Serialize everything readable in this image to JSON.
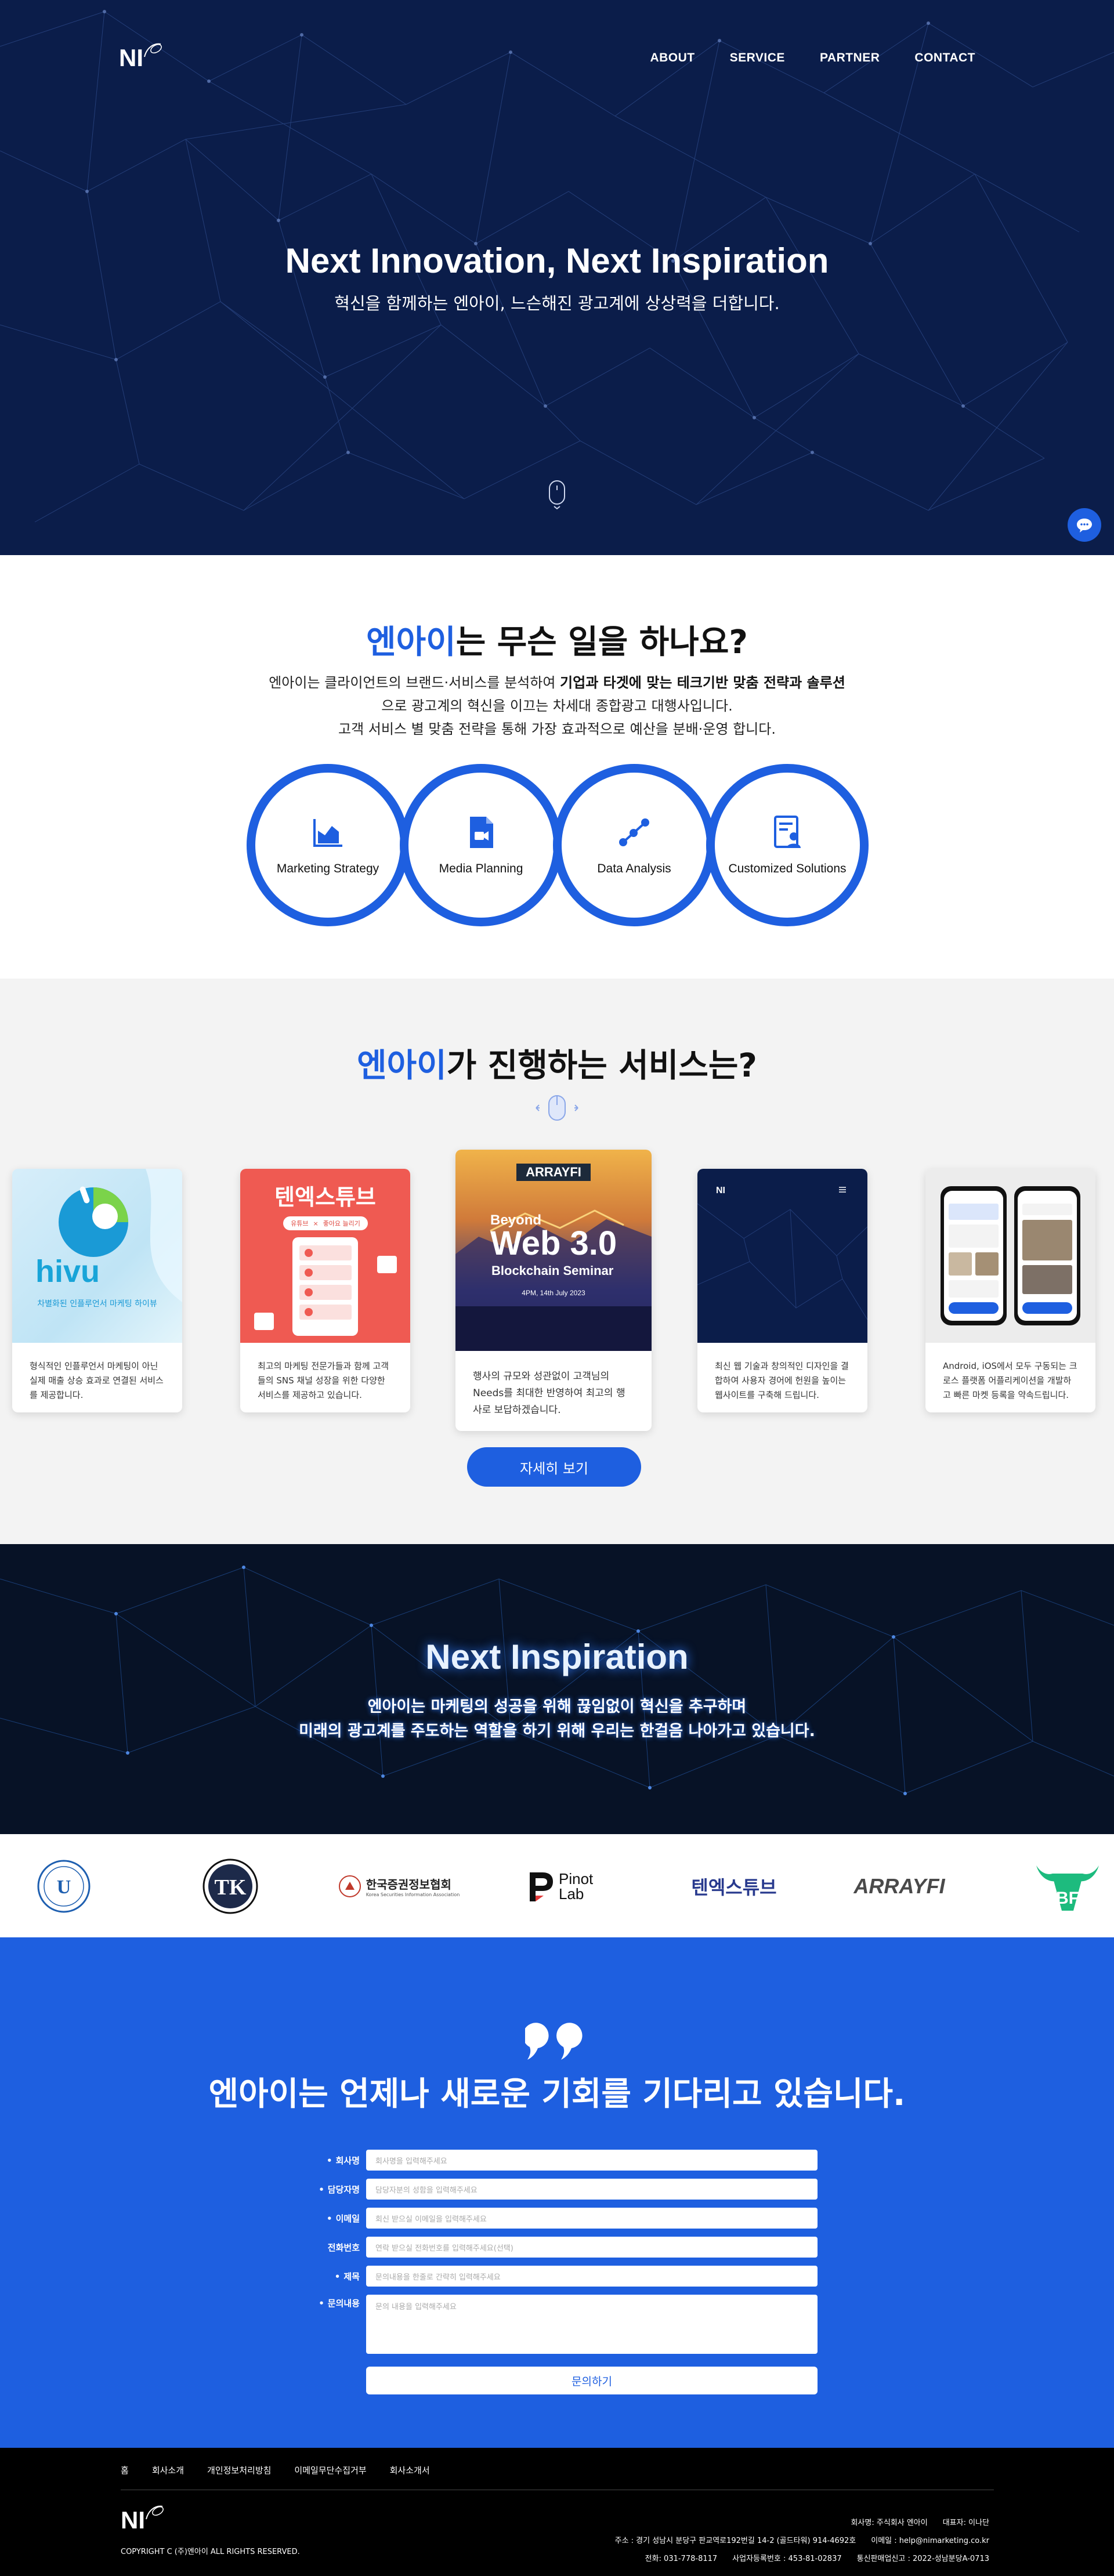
{
  "header": {
    "logo_text": "NI",
    "nav": [
      "ABOUT",
      "SERVICE",
      "PARTNER",
      "CONTACT"
    ]
  },
  "hero": {
    "title": "Next Innovation, Next Inspiration",
    "subtitle": "혁신을 함께하는 엔아이, 느슨해진 광고계에 상상력을 더합니다."
  },
  "what": {
    "title_highlight": "엔아이",
    "title_rest": "는 무슨 일을 하나요?",
    "line1_a": "엔아이는 클라이언트의 브랜드·서비스를 분석하여 ",
    "line1_b": "기업과 타겟에 맞는 테크기반 맞춤 전략과 솔루션",
    "line2": "으로 광고계의 혁신을 이끄는 차세대 종합광고 대행사입니다.",
    "line3": "고객 서비스 별 맞춤 전략을 통해 가장 효과적으로 예산을 분배·운영 합니다.",
    "circles": [
      "Marketing Strategy",
      "Media Planning",
      "Data Analysis",
      "Customized Solutions"
    ]
  },
  "services": {
    "title_highlight": "엔아이",
    "title_rest": "가 진행하는 서비스는?",
    "cards": [
      {
        "brand": "hivu",
        "caption": "차별화된 인플루언서 마케팅 하이뷰",
        "desc": "형식적인 인플루언서 마케팅이 아닌 실제 매출 상승 효과로 연결된 서비스를 제공합니다."
      },
      {
        "brand": "텐엑스튜브",
        "tag1": "유튜브",
        "tag2": "좋아요 늘리기",
        "desc": "최고의 마케팅 전문가들과 함께 고객들의 SNS 채널 성장을 위한 다양한 서비스를 제공하고 있습니다."
      },
      {
        "brand": "ARRAYFI",
        "headline1": "Beyond",
        "headline2": "Web 3.0",
        "headline3": "Blockchain Seminar",
        "date": "4PM, 14th July 2023",
        "desc": "행사의 규모와 성관없이 고객님의 Needs를 최대한 반영하여 최고의 행사로 보답하겠습니다."
      },
      {
        "brand": "NI",
        "desc": "최신 웹 기술과 창의적인 디자인을 결합하여 사용자 경어에 헌원을 높이는 웹사이트를 구축해 드립니다."
      },
      {
        "brand": "app",
        "desc": "Android, iOS에서 모두 구동되는 크로스 플랫폼 어플리케이션을 개발하고 빠른 마켓 등록을 약속드립니다."
      }
    ],
    "more_button": "자세히 보기"
  },
  "inspiration": {
    "title": "Next Inspiration",
    "line1": "엔아이는 마케팅의 성공을 위해 끊임없이 혁신을 추구하며",
    "line2": "미래의 광고계를 주도하는 역할을 하기 위해 우리는 한걸음 나아가고 있습니다."
  },
  "partners": [
    {
      "name": "U"
    },
    {
      "name": "TK"
    },
    {
      "name": "한국증권정보협회",
      "sub": "Korea Securities Information Association"
    },
    {
      "name": "Pinot Lab"
    },
    {
      "name": "텐엑스튜브"
    },
    {
      "name": "ARRAYFI"
    },
    {
      "name": "BF"
    }
  ],
  "contact": {
    "title": "엔아이는 언제나 새로운 기회를 기다리고 있습니다.",
    "fields": [
      {
        "label": "회사명",
        "required": true,
        "placeholder": "회사명을 입력해주세요"
      },
      {
        "label": "담당자명",
        "required": true,
        "placeholder": "담당자분의 성함을 입력해주세요"
      },
      {
        "label": "이메일",
        "required": true,
        "placeholder": "회신 받으실 이메일을 입력해주세요"
      },
      {
        "label": "전화번호",
        "required": false,
        "placeholder": "연락 받으실 전화번호를 입력해주세요(선택)"
      },
      {
        "label": "제목",
        "required": true,
        "placeholder": "문의내용을 한줄로 간략히 입력해주세요"
      },
      {
        "label": "문의내용",
        "required": true,
        "placeholder": "문의 내용을 입력해주세요"
      }
    ],
    "submit": "문의하기"
  },
  "footer": {
    "links": [
      "홈",
      "회사소개",
      "개인정보처리방침",
      "이메일무단수집거부",
      "회사소개서"
    ],
    "copyright": "COPYRIGHT C (주)엔아이 ALL RIGHTS RESERVED.",
    "company": "회사명: 주식회사 엔아이",
    "ceo": "대표자: 이나단",
    "address": "주소 : 경기 성남시 분당구 판교역로192번길 14-2 (골드타워) 914-4692호",
    "email": "이메일 : help@nimarketing.co.kr",
    "phone": "전화: 031-778-8117",
    "biz_no": "사업자등록번호 : 453-81-02837",
    "ecommerce": "통신판매업신고 : 2022-성남분당A-0713"
  },
  "colors": {
    "primary": "#1e5fe0",
    "hero_bg": "#0b1d4a",
    "footer_bg": "#000000"
  }
}
